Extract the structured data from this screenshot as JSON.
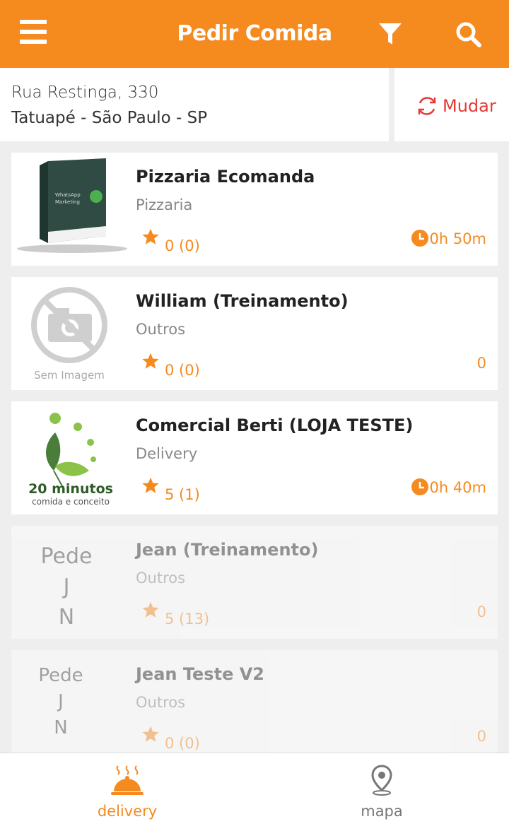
{
  "header": {
    "title": "Pedir Comida"
  },
  "address": {
    "line1": "Rua Restinga, 330",
    "line2": "Tatuapé - São Paulo - SP",
    "change_label": "Mudar"
  },
  "restaurants": [
    {
      "name": "Pizzaria Ecomanda",
      "category": "Pizzaria",
      "rating": "0 (0)",
      "delivery_time": "0h 50m",
      "thumb_text": [
        "WhatsApp",
        "Marketing"
      ]
    },
    {
      "name": "William (Treinamento)",
      "category": "Outros",
      "rating": "0 (0)",
      "delivery_time": "0",
      "thumb_text": [
        "Sem Imagem"
      ]
    },
    {
      "name": "Comercial Berti (LOJA TESTE)",
      "category": "Delivery",
      "rating": "5 (1)",
      "delivery_time": "0h 40m",
      "thumb_text": [
        "20 minutos",
        "comida e conceito"
      ]
    },
    {
      "name": "Jean (Treinamento)",
      "category": "Outros",
      "rating": "5 (13)",
      "delivery_time": "0",
      "thumb_text": [
        "Pede",
        "J",
        "N"
      ]
    },
    {
      "name": "Jean Teste V2",
      "category": "Outros",
      "rating": "0 (0)",
      "delivery_time": "0",
      "thumb_text": [
        "Pede",
        "J",
        "N"
      ]
    }
  ],
  "nav": {
    "delivery_label": "delivery",
    "map_label": "mapa"
  },
  "colors": {
    "accent": "#f58a1f",
    "danger": "#e53935",
    "inactive": "#777777"
  },
  "icons": {
    "menu": "menu-icon",
    "filter": "filter-icon",
    "search": "search-icon",
    "refresh": "refresh-icon",
    "star": "star-icon",
    "clock": "clock-icon",
    "cloche": "cloche-icon",
    "map_pin": "map-pin-icon"
  }
}
